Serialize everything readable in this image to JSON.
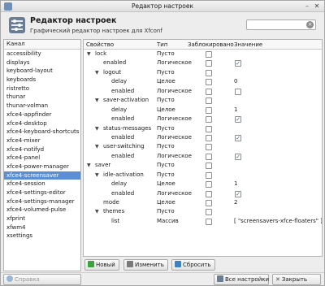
{
  "window": {
    "title": "Редактор настроек"
  },
  "header": {
    "title": "Редактор настроек",
    "subtitle": "Графический редактор настроек для Xfconf"
  },
  "channels": {
    "header": "Канал",
    "items": [
      "accessibility",
      "displays",
      "keyboard-layout",
      "keyboards",
      "ristretto",
      "thunar",
      "thunar-volman",
      "xfce4-appfinder",
      "xfce4-desktop",
      "xfce4-keyboard-shortcuts",
      "xfce4-mixer",
      "xfce4-notifyd",
      "xfce4-panel",
      "xfce4-power-manager",
      "xfce4-screensaver",
      "xfce4-session",
      "xfce4-settings-editor",
      "xfce4-settings-manager",
      "xfce4-volumed-pulse",
      "xfprint",
      "xfwm4",
      "xsettings"
    ],
    "selected": "xfce4-screensaver"
  },
  "grid": {
    "columns": {
      "property": "Свойство",
      "type": "Тип",
      "locked": "Заблокировано",
      "value": "Значение"
    },
    "rows": [
      {
        "name": "lock",
        "type": "Пусто",
        "value": ""
      },
      {
        "name": "enabled",
        "type": "Логическое",
        "value": ""
      },
      {
        "name": "logout",
        "type": "Пусто",
        "value": ""
      },
      {
        "name": "delay",
        "type": "Целое",
        "value": "0"
      },
      {
        "name": "enabled",
        "type": "Логическое",
        "value": ""
      },
      {
        "name": "saver-activation",
        "type": "Пусто",
        "value": ""
      },
      {
        "name": "delay",
        "type": "Целое",
        "value": "1"
      },
      {
        "name": "enabled",
        "type": "Логическое",
        "value": ""
      },
      {
        "name": "status-messages",
        "type": "Пусто",
        "value": ""
      },
      {
        "name": "enabled",
        "type": "Логическое",
        "value": ""
      },
      {
        "name": "user-switching",
        "type": "Пусто",
        "value": ""
      },
      {
        "name": "enabled",
        "type": "Логическое",
        "value": ""
      },
      {
        "name": "saver",
        "type": "Пусто",
        "value": ""
      },
      {
        "name": "idle-activation",
        "type": "Пусто",
        "value": ""
      },
      {
        "name": "delay",
        "type": "Целое",
        "value": "1"
      },
      {
        "name": "enabled",
        "type": "Логическое",
        "value": ""
      },
      {
        "name": "mode",
        "type": "Целое",
        "value": "2"
      },
      {
        "name": "themes",
        "type": "Пусто",
        "value": ""
      },
      {
        "name": "list",
        "type": "Массив",
        "value": "[ \"screensavers-xfce-floaters\" ]"
      }
    ],
    "checked_values": [
      1,
      7,
      9,
      11,
      15
    ]
  },
  "buttons": {
    "new": "Новый",
    "edit": "Изменить",
    "reset": "Сбросить",
    "help": "Справка",
    "all_settings": "Все настройки",
    "close": "Закрыть"
  },
  "colors": {
    "selection": "#5b8ed3",
    "accent_blue": "#2a5fb0"
  }
}
